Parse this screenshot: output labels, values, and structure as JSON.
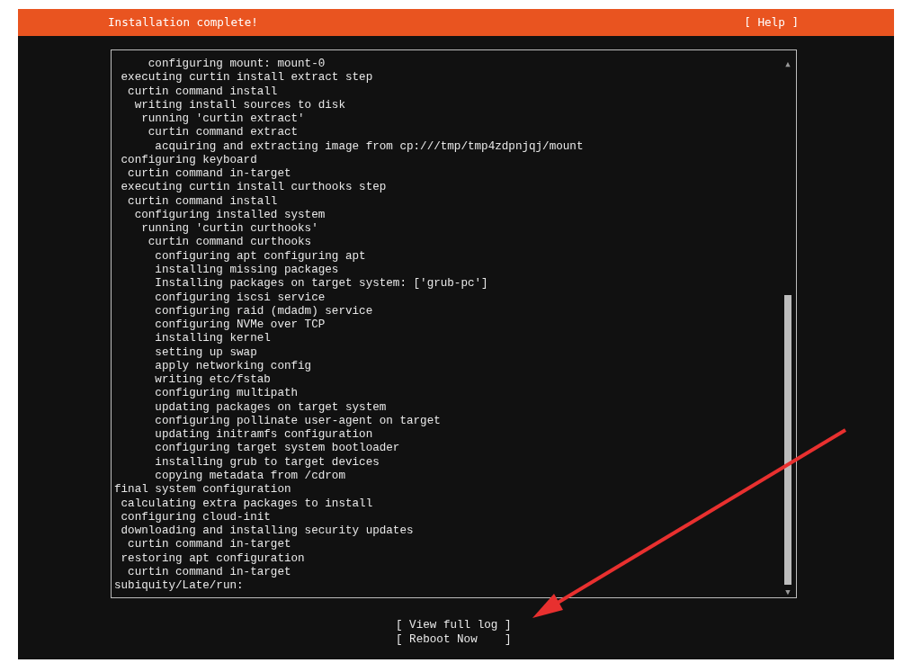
{
  "header": {
    "title": "Installation complete!",
    "help": "[ Help ]"
  },
  "log": {
    "lines": [
      "     configuring mount: mount-0",
      " executing curtin install extract step",
      "  curtin command install",
      "   writing install sources to disk",
      "    running 'curtin extract'",
      "     curtin command extract",
      "      acquiring and extracting image from cp:///tmp/tmp4zdpnjqj/mount",
      " configuring keyboard",
      "  curtin command in-target",
      " executing curtin install curthooks step",
      "  curtin command install",
      "   configuring installed system",
      "    running 'curtin curthooks'",
      "     curtin command curthooks",
      "      configuring apt configuring apt",
      "      installing missing packages",
      "      Installing packages on target system: ['grub-pc']",
      "      configuring iscsi service",
      "      configuring raid (mdadm) service",
      "      configuring NVMe over TCP",
      "      installing kernel",
      "      setting up swap",
      "      apply networking config",
      "      writing etc/fstab",
      "      configuring multipath",
      "      updating packages on target system",
      "      configuring pollinate user-agent on target",
      "      updating initramfs configuration",
      "      configuring target system bootloader",
      "      installing grub to target devices",
      "      copying metadata from /cdrom",
      "final system configuration",
      " calculating extra packages to install",
      " configuring cloud-init",
      " downloading and installing security updates",
      "  curtin command in-target",
      " restoring apt configuration",
      "  curtin command in-target",
      "subiquity/Late/run:"
    ],
    "scroll_up": "▲",
    "scroll_down": "▼"
  },
  "buttons": [
    "[ View full log ]",
    "[ Reboot Now    ]"
  ]
}
